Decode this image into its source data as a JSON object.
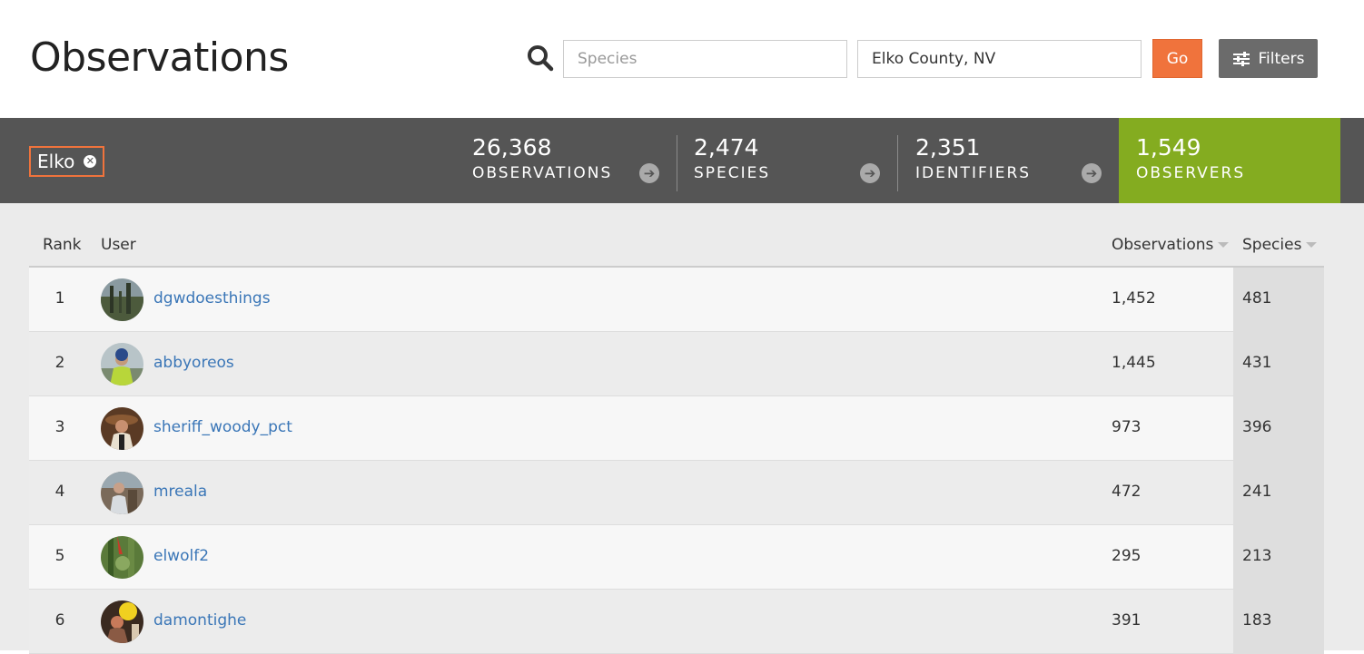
{
  "header": {
    "title": "Observations",
    "species_placeholder": "Species",
    "place_value": "Elko County, NV",
    "go_label": "Go",
    "filters_label": "Filters"
  },
  "stats": {
    "place_chip": "Elko",
    "observations": {
      "value": "26,368",
      "label": "OBSERVATIONS"
    },
    "species": {
      "value": "2,474",
      "label": "SPECIES"
    },
    "identifiers": {
      "value": "2,351",
      "label": "IDENTIFIERS"
    },
    "observers": {
      "value": "1,549",
      "label": "OBSERVERS"
    },
    "active_color": "#84ac20"
  },
  "table": {
    "headers": {
      "rank": "Rank",
      "user": "User",
      "observations": "Observations",
      "species": "Species"
    },
    "rows": [
      {
        "rank": "1",
        "login": "dgwdoesthings",
        "observations": "1,452",
        "species": "481"
      },
      {
        "rank": "2",
        "login": "abbyoreos",
        "observations": "1,445",
        "species": "431"
      },
      {
        "rank": "3",
        "login": "sheriff_woody_pct",
        "observations": "973",
        "species": "396"
      },
      {
        "rank": "4",
        "login": "mreala",
        "observations": "472",
        "species": "241"
      },
      {
        "rank": "5",
        "login": "elwolf2",
        "observations": "295",
        "species": "213"
      },
      {
        "rank": "6",
        "login": "damontighe",
        "observations": "391",
        "species": "183"
      }
    ]
  }
}
